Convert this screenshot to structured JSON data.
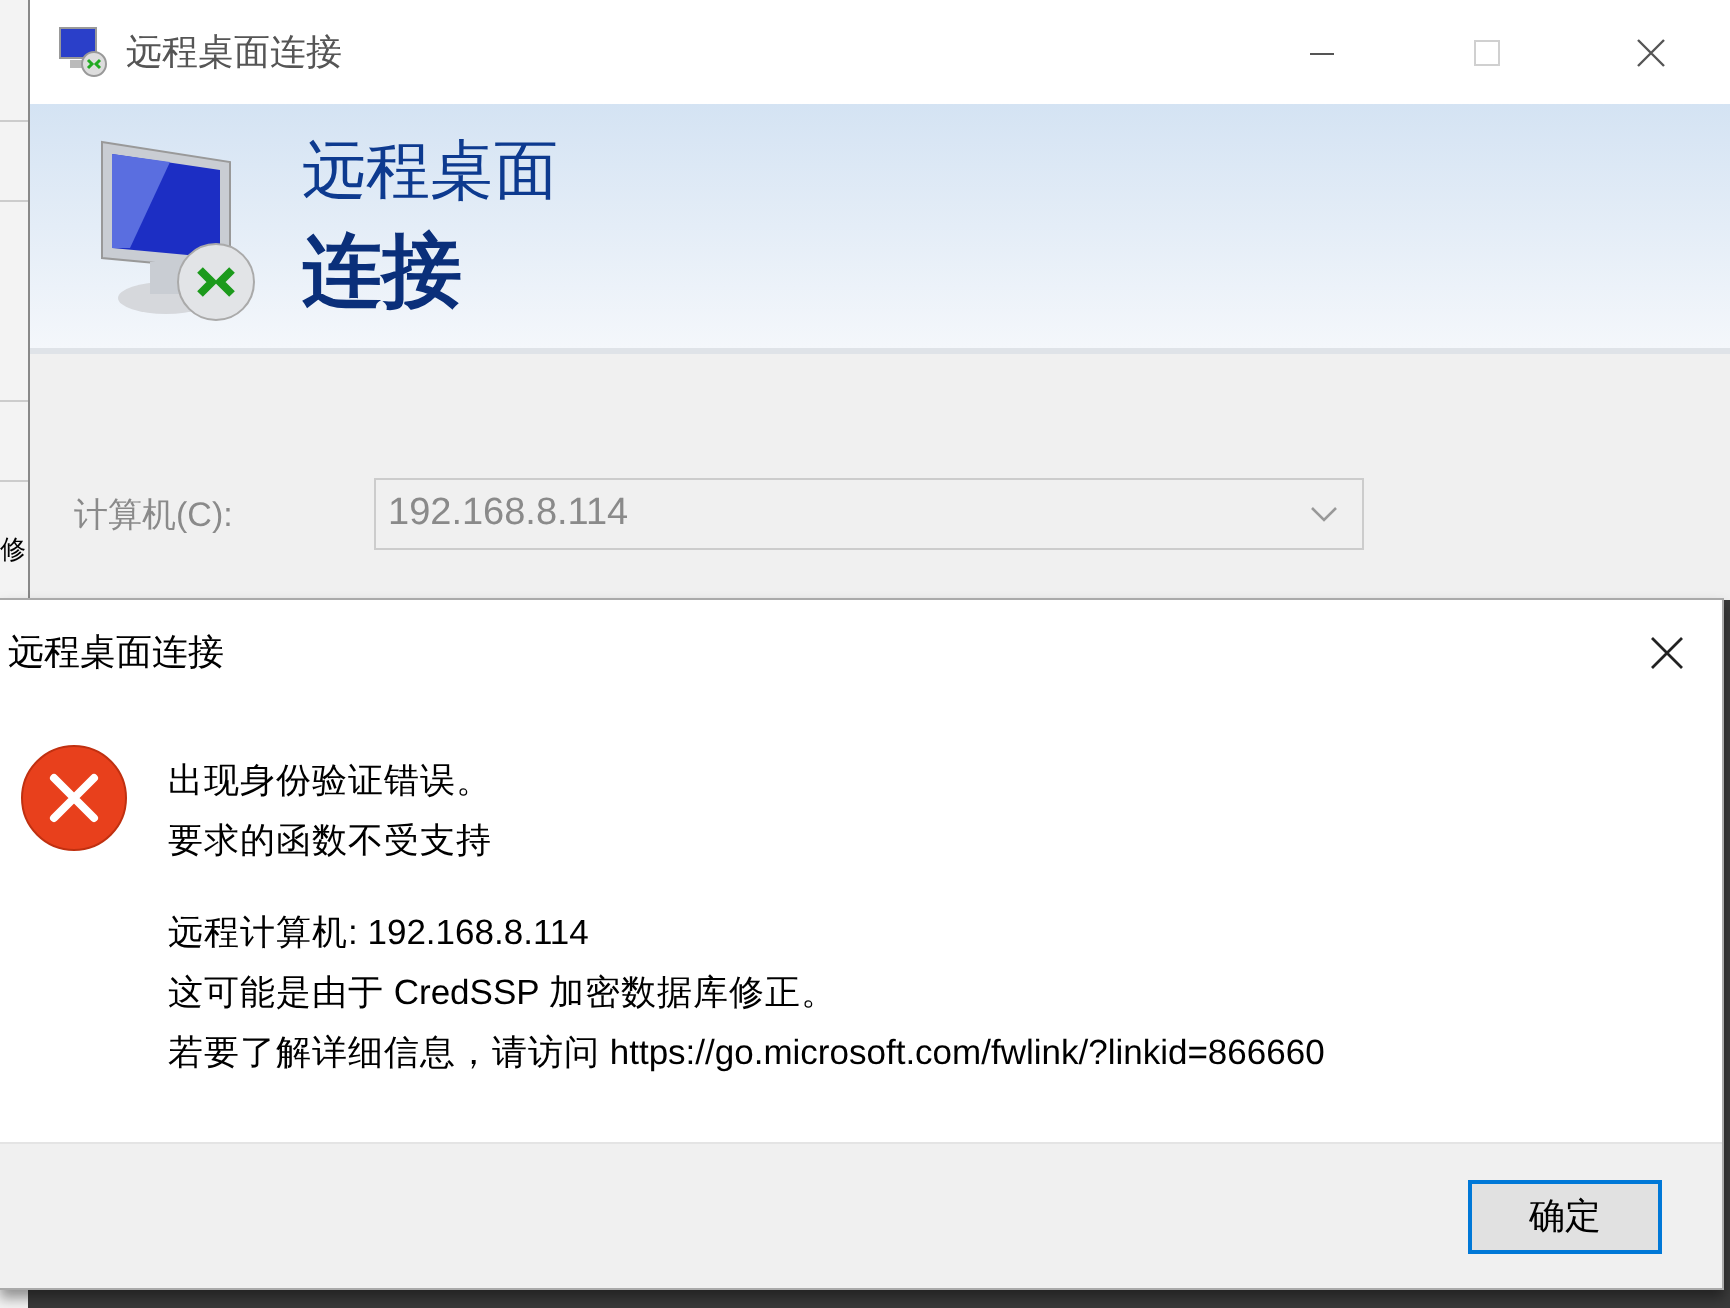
{
  "background_fragment": {
    "text": "修"
  },
  "background_window": {
    "title": "远程桌面连接",
    "controls": [
      {
        "kind": "minimize",
        "disabled": false
      },
      {
        "kind": "maximize",
        "disabled": true
      },
      {
        "kind": "close",
        "disabled": false
      }
    ],
    "banner": {
      "line_1": "远程桌面",
      "line_2": "连接"
    },
    "computer_field": {
      "label": "计算机(C):",
      "value": "192.168.8.114",
      "disabled": true
    }
  },
  "dialog": {
    "title": "远程桌面连接",
    "paragraphs": [
      [
        "出现身份验证错误。",
        "要求的函数不受支持"
      ],
      [
        "远程计算机: 192.168.8.114",
        "这可能是由于 CredSSP 加密数据库修正。",
        "若要了解详细信息，请访问 https://go.microsoft.com/fwlink/?linkid=866660"
      ]
    ],
    "buttons": [
      {
        "label": "确定",
        "default": true
      }
    ]
  }
}
